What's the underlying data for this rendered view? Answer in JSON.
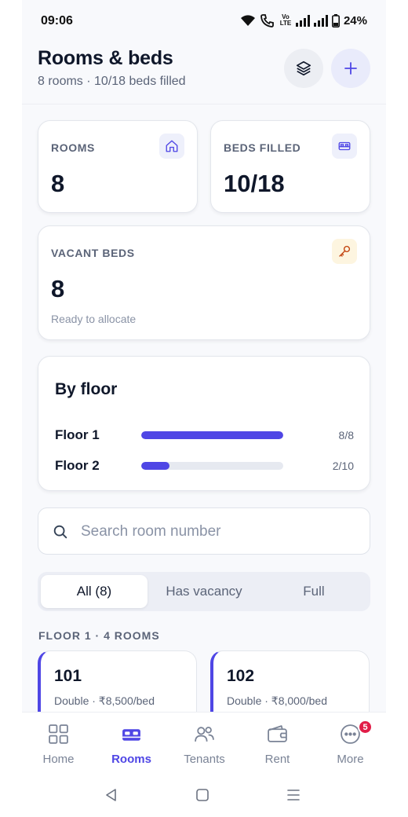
{
  "status_bar": {
    "time": "09:06",
    "battery": "24%",
    "volte": "Vo LTE"
  },
  "header": {
    "title": "Rooms & beds",
    "subtitle": "8 rooms · 10/18 beds filled"
  },
  "stats": {
    "rooms": {
      "label": "ROOMS",
      "value": "8",
      "icon": "home-icon"
    },
    "beds_filled": {
      "label": "BEDS FILLED",
      "value": "10/18",
      "icon": "bed-icon"
    },
    "vacant_beds": {
      "label": "VACANT BEDS",
      "value": "8",
      "note": "Ready to allocate",
      "icon": "key-icon"
    }
  },
  "by_floor": {
    "title": "By floor",
    "floors": [
      {
        "name": "Floor 1",
        "count": "8/8",
        "fill": 1.0
      },
      {
        "name": "Floor 2",
        "count": "2/10",
        "fill": 0.2
      }
    ]
  },
  "search": {
    "placeholder": "Search room number",
    "value": ""
  },
  "filters": [
    {
      "label": "All (8)",
      "active": true
    },
    {
      "label": "Has vacancy",
      "active": false
    },
    {
      "label": "Full",
      "active": false
    }
  ],
  "section": {
    "label": "FLOOR 1 · 4 ROOMS"
  },
  "rooms": [
    {
      "number": "101",
      "meta": "Double · ₹8,500/bed"
    },
    {
      "number": "102",
      "meta": "Double · ₹8,000/bed"
    }
  ],
  "bottom_nav": [
    {
      "label": "Home",
      "icon": "grid-icon",
      "active": false
    },
    {
      "label": "Rooms",
      "icon": "bed-icon",
      "active": true
    },
    {
      "label": "Tenants",
      "icon": "users-icon",
      "active": false
    },
    {
      "label": "Rent",
      "icon": "wallet-icon",
      "active": false
    },
    {
      "label": "More",
      "icon": "more-icon",
      "active": false,
      "badge": "5"
    }
  ],
  "colors": {
    "accent": "#4f46e5",
    "badge": "#e11d48",
    "key_icon": "#c2410c"
  }
}
